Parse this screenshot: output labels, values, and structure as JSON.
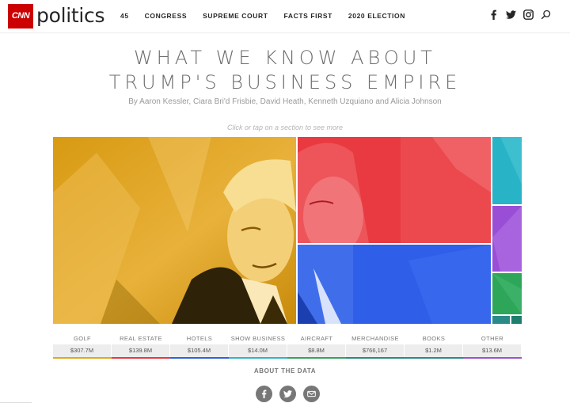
{
  "header": {
    "brand": "CNN",
    "section": "politics",
    "nav": [
      "45",
      "CONGRESS",
      "SUPREME COURT",
      "FACTS FIRST",
      "2020 ELECTION"
    ],
    "social_icons": [
      "facebook-icon",
      "twitter-icon",
      "instagram-icon",
      "search-icon"
    ]
  },
  "article": {
    "headline_line1": "WHAT WE KNOW ABOUT",
    "headline_line2": "TRUMP'S BUSINESS EMPIRE",
    "byline": "By Aaron Kessler, Ciara Bri'd Frisbie, David Heath, Kenneth Uzquiano and Alicia Johnson",
    "instruction": "Click or tap on a section to see more"
  },
  "treemap": {
    "sections": [
      {
        "name": "GOLF",
        "value": "$307.7M",
        "color": "#e0a914"
      },
      {
        "name": "REAL ESTATE",
        "value": "$139.8M",
        "color": "#e8383d"
      },
      {
        "name": "HOTELS",
        "value": "$105.4M",
        "color": "#2f5fe6"
      },
      {
        "name": "SHOW BUSINESS",
        "value": "$14.0M",
        "color": "#2bb5c8"
      },
      {
        "name": "AIRCRAFT",
        "value": "$8.8M",
        "color": "#2ea65a"
      },
      {
        "name": "MERCHANDISE",
        "value": "$766,167",
        "color": "#1d8f7a"
      },
      {
        "name": "BOOKS",
        "value": "$1.2M",
        "color": "#2a8a8a"
      },
      {
        "name": "OTHER",
        "value": "$13.6M",
        "color": "#9b4fd6"
      }
    ]
  },
  "footer": {
    "about": "ABOUT THE DATA",
    "share_icons": [
      "facebook-icon",
      "twitter-icon",
      "email-icon"
    ]
  }
}
